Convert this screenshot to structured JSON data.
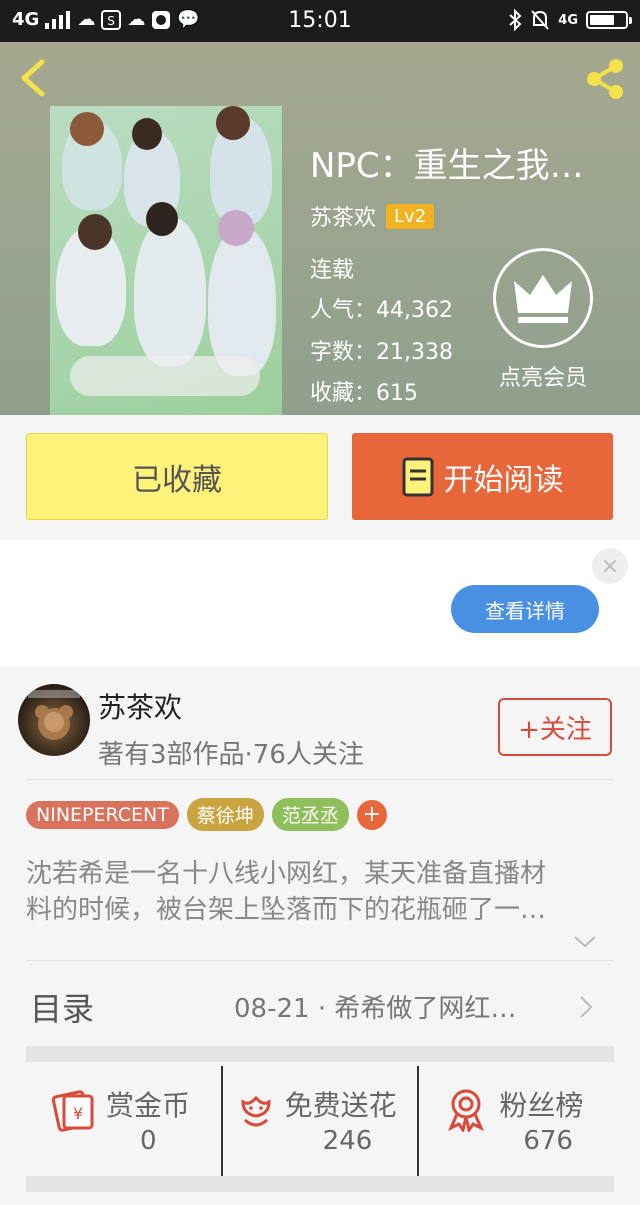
{
  "status_bar": {
    "network": "4G",
    "time": "15:01",
    "right_network": "4G"
  },
  "book": {
    "title": "NPC：重生之我…",
    "author": "苏茶欢",
    "level": "Lv2",
    "status": "连载",
    "popularity": "人气：44,362",
    "word_count": "字数：21,338",
    "favorites": "收藏：615",
    "vip_label": "点亮会员"
  },
  "actions": {
    "favorited_label": "已收藏",
    "read_label": "开始阅读"
  },
  "ad": {
    "button_label": "查看详情",
    "close_glyph": "×"
  },
  "author_card": {
    "name": "苏茶欢",
    "meta": "著有3部作品·76人关注",
    "follow_label": "+关注",
    "tags": [
      {
        "label": "NINEPERCENT",
        "color": "#d9735e"
      },
      {
        "label": "蔡徐坤",
        "color": "#c9a440"
      },
      {
        "label": "范丞丞",
        "color": "#8fbf5a"
      }
    ],
    "tag_add": "+",
    "description_line1": "沈若希是一名十八线小网红，某天准备直播材",
    "description_line2": "料的时候，被台架上坠落而下的花瓶砸了一…"
  },
  "toc": {
    "label": "目录",
    "latest": "08-21 · 希希做了网红…"
  },
  "stats": [
    {
      "title": "赏金币",
      "value": "0",
      "icon": "red-envelope-icon"
    },
    {
      "title": "免费送花",
      "value": "246",
      "icon": "flower-icon"
    },
    {
      "title": "粉丝榜",
      "value": "676",
      "icon": "medal-icon"
    }
  ],
  "colors": {
    "accent_orange": "#e8673a",
    "accent_yellow": "#fff27a",
    "ad_blue": "#4a90e2",
    "follow_red": "#d84a3a"
  }
}
